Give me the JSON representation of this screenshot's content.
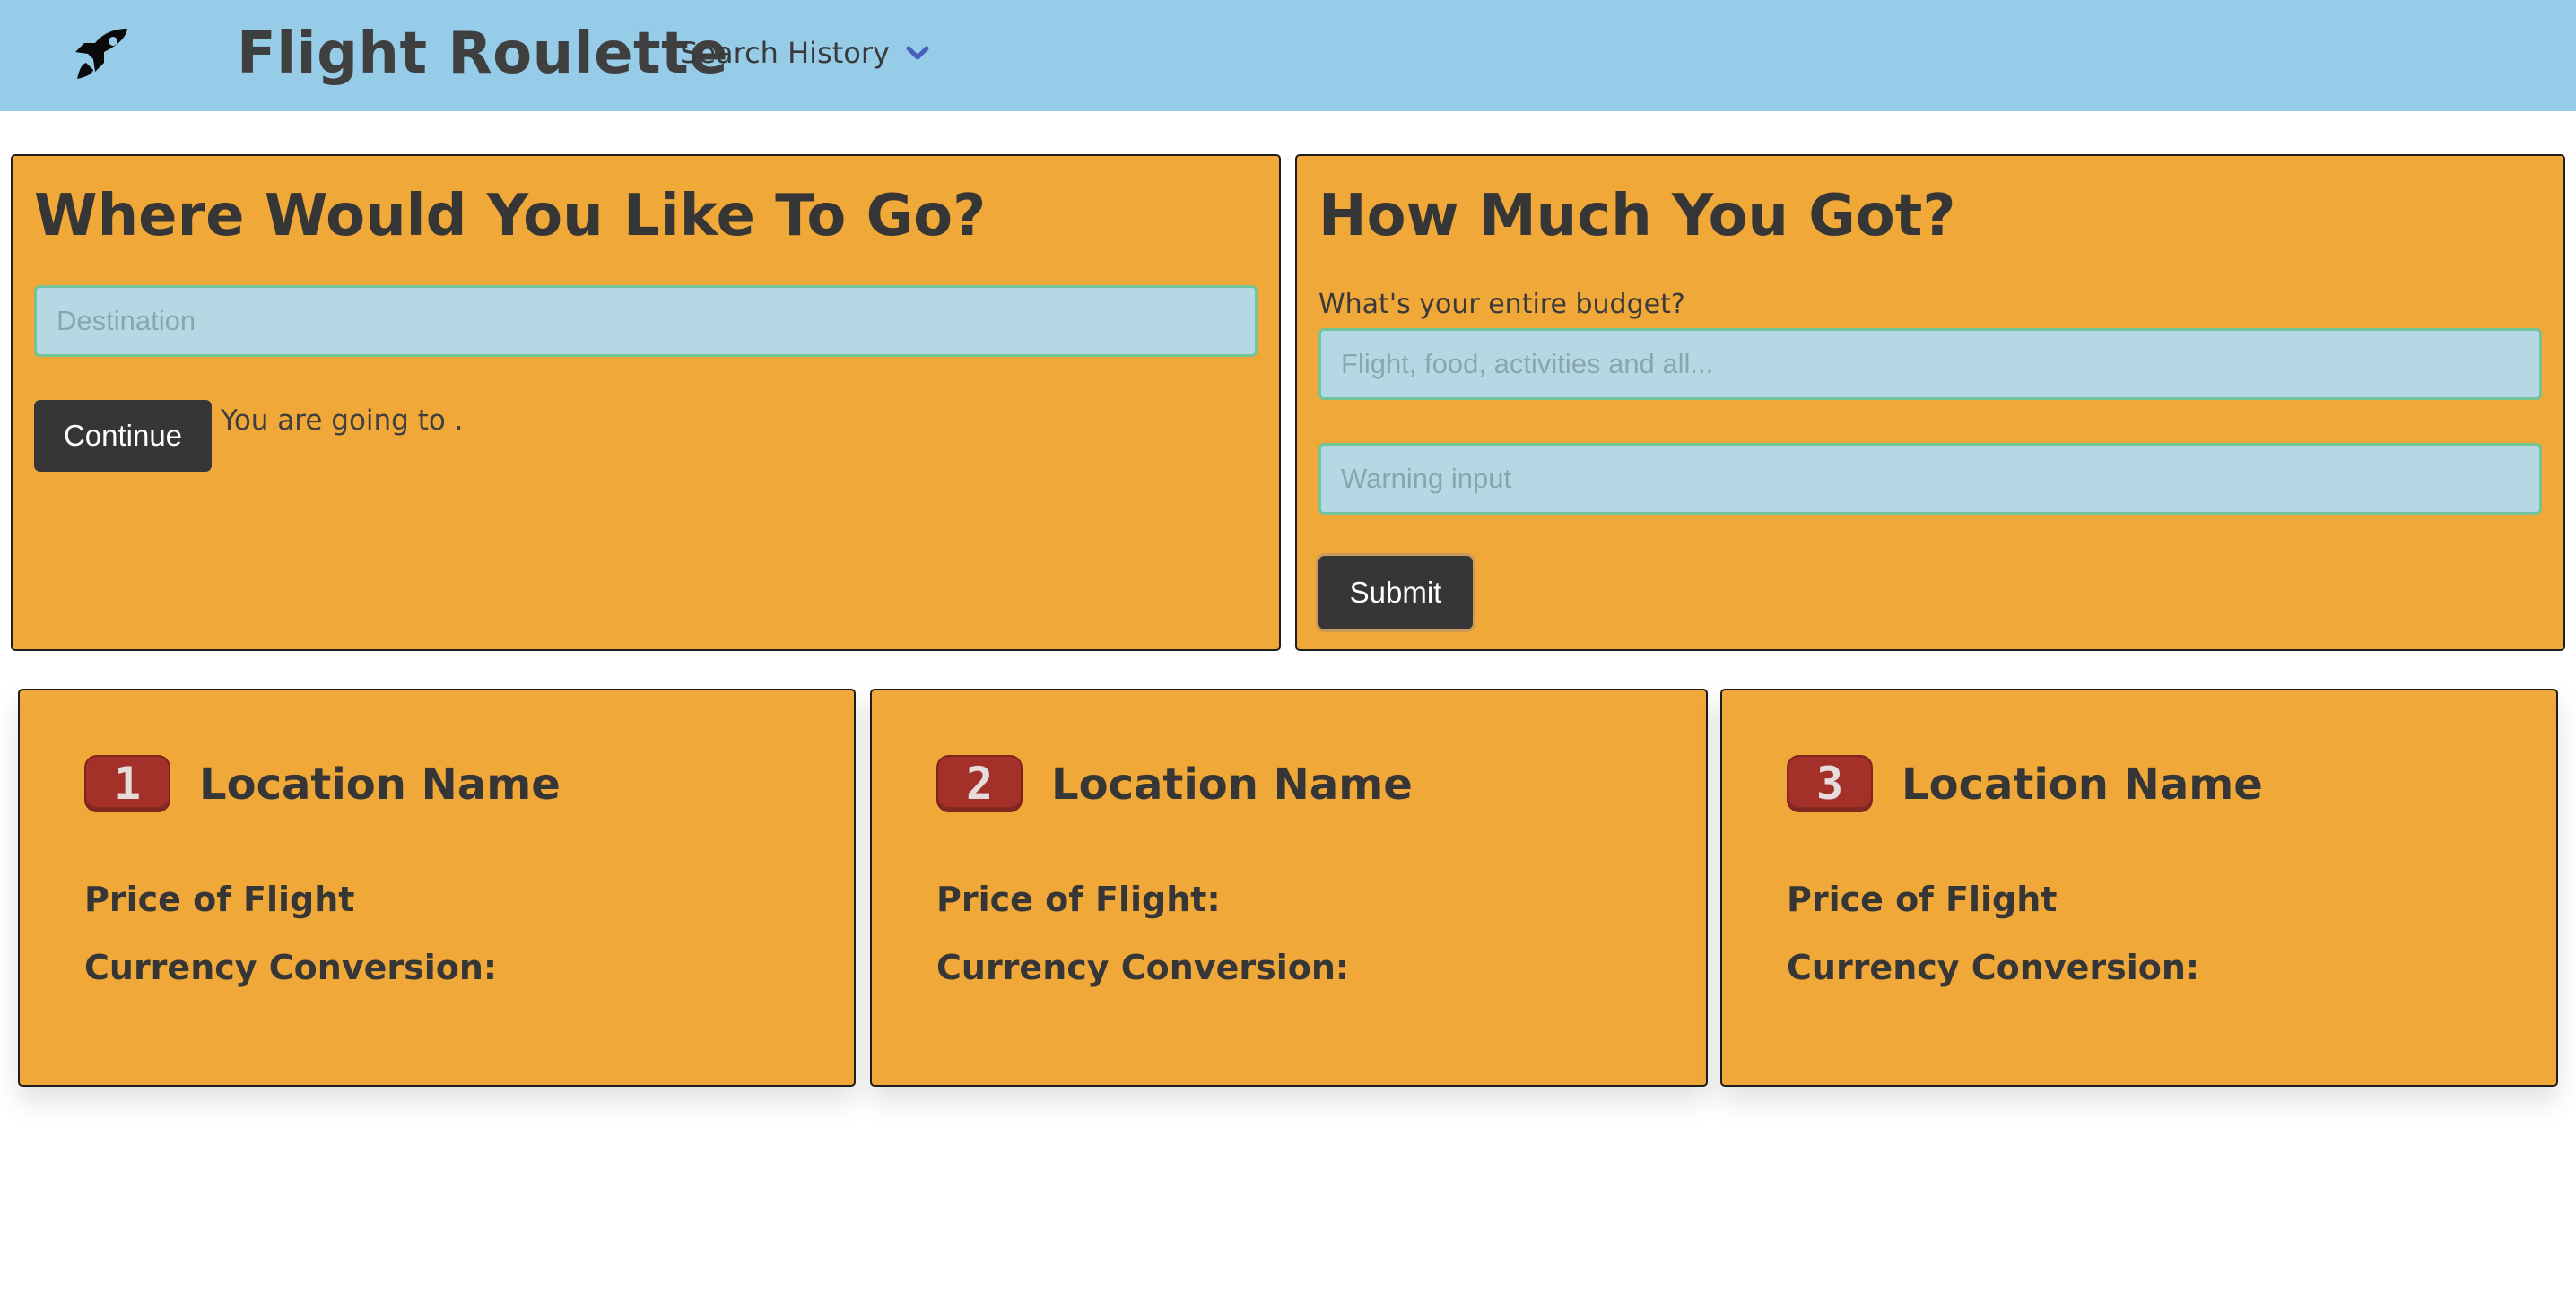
{
  "navbar": {
    "logo_icon": "rocket-icon",
    "brand": "Flight Roulette",
    "history_label": "Search History",
    "history_icon": "chevron-down-icon"
  },
  "destination_panel": {
    "title": "Where Would You Like To Go?",
    "input_placeholder": "Destination",
    "input_value": "",
    "continue_label": "Continue",
    "going_text": "You are going to ."
  },
  "budget_panel": {
    "title": "How Much You Got?",
    "budget_label": "What's your entire budget?",
    "budget_placeholder": "Flight, food, activities and all...",
    "warning_placeholder": "Warning input",
    "submit_label": "Submit"
  },
  "results": [
    {
      "rank": "1",
      "location": "Location Name",
      "price_label": "Price of Flight",
      "currency_label": "Currency Conversion:"
    },
    {
      "rank": "2",
      "location": "Location Name",
      "price_label": "Price of Flight:",
      "currency_label": "Currency Conversion:"
    },
    {
      "rank": "3",
      "location": "Location Name",
      "price_label": "Price of Flight",
      "currency_label": "Currency Conversion:"
    }
  ],
  "colors": {
    "navbar_bg": "#96cce8",
    "panel_bg": "#f0a838",
    "input_bg": "#b5d9e4",
    "input_border": "#74c49a",
    "button_bg": "#363636",
    "badge_bg": "#a3312a",
    "chevron": "#4a5ec0"
  }
}
